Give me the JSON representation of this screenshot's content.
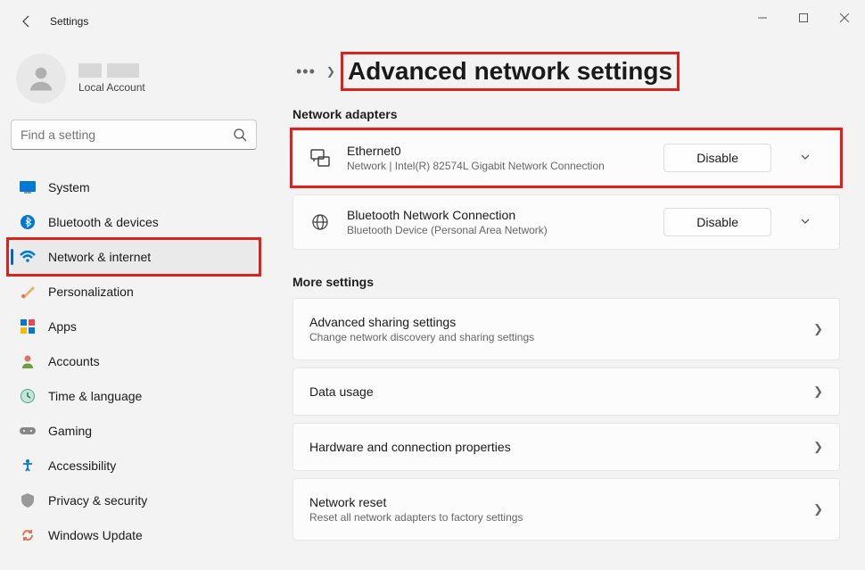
{
  "window": {
    "title": "Settings"
  },
  "profile": {
    "type": "Local Account"
  },
  "search": {
    "placeholder": "Find a setting"
  },
  "sidebar": {
    "items": [
      {
        "label": "System"
      },
      {
        "label": "Bluetooth & devices"
      },
      {
        "label": "Network & internet"
      },
      {
        "label": "Personalization"
      },
      {
        "label": "Apps"
      },
      {
        "label": "Accounts"
      },
      {
        "label": "Time & language"
      },
      {
        "label": "Gaming"
      },
      {
        "label": "Accessibility"
      },
      {
        "label": "Privacy & security"
      },
      {
        "label": "Windows Update"
      }
    ]
  },
  "breadcrumb": {
    "title": "Advanced network settings"
  },
  "sections": {
    "adapters_label": "Network adapters",
    "more_label": "More settings"
  },
  "adapters": [
    {
      "name": "Ethernet0",
      "description": "Network | Intel(R) 82574L Gigabit Network Connection",
      "action": "Disable"
    },
    {
      "name": "Bluetooth Network Connection",
      "description": "Bluetooth Device (Personal Area Network)",
      "action": "Disable"
    }
  ],
  "more_settings": [
    {
      "title": "Advanced sharing settings",
      "sub": "Change network discovery and sharing settings"
    },
    {
      "title": "Data usage",
      "sub": ""
    },
    {
      "title": "Hardware and connection properties",
      "sub": ""
    },
    {
      "title": "Network reset",
      "sub": "Reset all network adapters to factory settings"
    }
  ]
}
